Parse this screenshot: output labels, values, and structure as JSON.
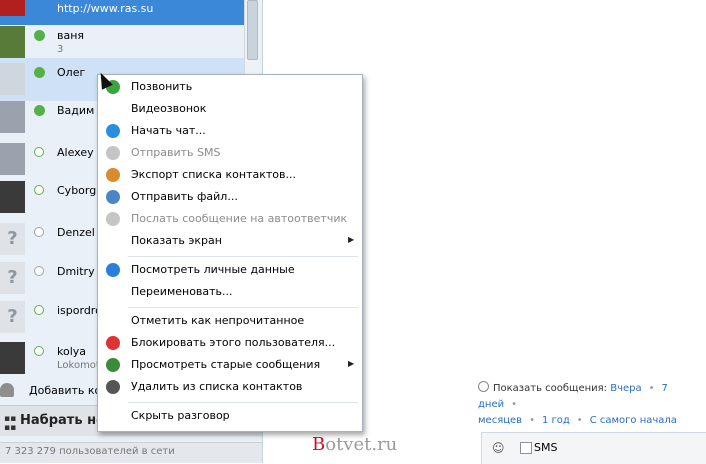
{
  "contacts": [
    {
      "name": "http://www.ras.su",
      "sub": "",
      "state": "sel"
    },
    {
      "name": "ваня",
      "sub": "3",
      "state": ""
    },
    {
      "name": "Олег",
      "sub": "",
      "state": "hl"
    },
    {
      "name": "Вадим (",
      "sub": "",
      "state": ""
    },
    {
      "name": "Alexey S",
      "sub": "",
      "state": ""
    },
    {
      "name": "Cyborg",
      "sub": "",
      "state": ""
    },
    {
      "name": "Denzel",
      "sub": "",
      "state": ""
    },
    {
      "name": "Dmitry K",
      "sub": "",
      "state": ""
    },
    {
      "name": "ispordro",
      "sub": "",
      "state": ""
    },
    {
      "name": "kolya",
      "sub": "Lokomot",
      "state": ""
    }
  ],
  "sidebar": {
    "add_contact": "Добавить конт",
    "dial": "Набрать ном",
    "status": "7 323 279 пользователей в сети"
  },
  "menu": {
    "items": [
      {
        "label": "Позвонить",
        "icon": "call-green-icon",
        "color": "#3aa53a"
      },
      {
        "label": "Видеозвонок",
        "icon": "",
        "color": ""
      },
      {
        "label": "Начать чат...",
        "icon": "chat-icon",
        "color": "#2a8ee0"
      },
      {
        "label": "Отправить SMS",
        "icon": "sms-icon",
        "color": "#c5c5c5",
        "disabled": true
      },
      {
        "label": "Экспорт списка контактов...",
        "icon": "export-contacts-icon",
        "color": "#d98b2e"
      },
      {
        "label": "Отправить файл...",
        "icon": "send-file-icon",
        "color": "#4a86c6"
      },
      {
        "label": "Послать сообщение на автоответчик",
        "icon": "voicemail-icon",
        "color": "#c5c5c5",
        "disabled": true
      },
      {
        "label": "Показать экран",
        "icon": "",
        "color": "",
        "submenu": true
      },
      {
        "label": "Посмотреть личные данные",
        "icon": "info-icon",
        "color": "#2a7fdc"
      },
      {
        "label": "Переименовать...",
        "icon": "",
        "color": ""
      },
      {
        "label": "Отметить как непрочитанное",
        "icon": "",
        "color": ""
      },
      {
        "label": "Блокировать этого пользователя...",
        "icon": "block-user-icon",
        "color": "#d33"
      },
      {
        "label": "Просмотреть старые сообщения",
        "icon": "clock-icon",
        "color": "#3a8b3a",
        "submenu": true
      },
      {
        "label": "Удалить из списка контактов",
        "icon": "trash-icon",
        "color": "#555"
      },
      {
        "label": "Скрыть разговор",
        "icon": "",
        "color": ""
      }
    ]
  },
  "history": {
    "label": "Показать сообщения:",
    "yesterday": "Вчера",
    "week": "7 дней",
    "months": "месяцев",
    "year": "1 год",
    "start": "С самого начала"
  },
  "watermark": {
    "first": "B",
    "rest": "otvet.ru"
  },
  "input": {
    "sms_label": "SMS",
    "smiley": "☺"
  }
}
